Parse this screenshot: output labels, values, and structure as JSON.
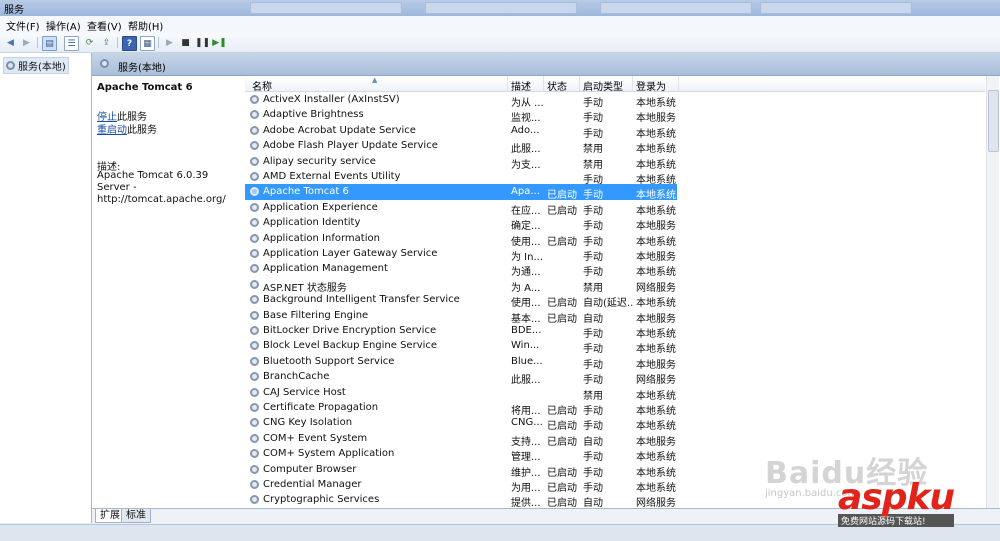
{
  "window": {
    "title": "服务"
  },
  "menu": [
    "文件(F)",
    "操作(A)",
    "查看(V)",
    "帮助(H)"
  ],
  "toolbar": {
    "icons": [
      "back-arrow-icon",
      "forward-arrow-icon",
      "console-tree-icon",
      "list-icon",
      "refresh-icon",
      "export-icon",
      "help-icon",
      "properties-icon",
      "play-icon",
      "stop-icon",
      "pause-icon",
      "restart-icon"
    ]
  },
  "tree": {
    "root_label": "服务(本地)"
  },
  "header": {
    "title": "服务(本地)"
  },
  "detail": {
    "service_name": "Apache Tomcat 6",
    "stop_link": "停止",
    "stop_suffix": "此服务",
    "restart_link": "重启动",
    "restart_suffix": "此服务",
    "desc_label": "描述:",
    "desc_text": "Apache Tomcat 6.0.39 Server - http://tomcat.apache.org/"
  },
  "columns": {
    "name": "名称",
    "desc": "描述",
    "status": "状态",
    "start": "启动类型",
    "logon": "登录为"
  },
  "rows": [
    {
      "name": "ActiveX Installer (AxInstSV)",
      "desc": "为从 ...",
      "status": "",
      "start": "手动",
      "logon": "本地系统"
    },
    {
      "name": "Adaptive Brightness",
      "desc": "监视...",
      "status": "",
      "start": "手动",
      "logon": "本地服务"
    },
    {
      "name": "Adobe Acrobat Update Service",
      "desc": "Ado...",
      "status": "",
      "start": "手动",
      "logon": "本地系统"
    },
    {
      "name": "Adobe Flash Player Update Service",
      "desc": "此服...",
      "status": "",
      "start": "禁用",
      "logon": "本地系统"
    },
    {
      "name": "Alipay security service",
      "desc": "为支...",
      "status": "",
      "start": "禁用",
      "logon": "本地系统"
    },
    {
      "name": "AMD External Events Utility",
      "desc": "",
      "status": "",
      "start": "手动",
      "logon": "本地系统"
    },
    {
      "name": "Apache Tomcat 6",
      "desc": "Apa...",
      "status": "已启动",
      "start": "手动",
      "logon": "本地系统",
      "selected": true
    },
    {
      "name": "Application Experience",
      "desc": "在应...",
      "status": "已启动",
      "start": "手动",
      "logon": "本地系统"
    },
    {
      "name": "Application Identity",
      "desc": "确定...",
      "status": "",
      "start": "手动",
      "logon": "本地服务"
    },
    {
      "name": "Application Information",
      "desc": "使用...",
      "status": "已启动",
      "start": "手动",
      "logon": "本地系统"
    },
    {
      "name": "Application Layer Gateway Service",
      "desc": "为 In...",
      "status": "",
      "start": "手动",
      "logon": "本地服务"
    },
    {
      "name": "Application Management",
      "desc": "为通...",
      "status": "",
      "start": "手动",
      "logon": "本地系统"
    },
    {
      "name": "ASP.NET 状态服务",
      "desc": "为 A...",
      "status": "",
      "start": "禁用",
      "logon": "网络服务"
    },
    {
      "name": "Background Intelligent Transfer Service",
      "desc": "使用...",
      "status": "已启动",
      "start": "自动(延迟...",
      "logon": "本地系统"
    },
    {
      "name": "Base Filtering Engine",
      "desc": "基本...",
      "status": "已启动",
      "start": "自动",
      "logon": "本地服务"
    },
    {
      "name": "BitLocker Drive Encryption Service",
      "desc": "BDE...",
      "status": "",
      "start": "手动",
      "logon": "本地系统"
    },
    {
      "name": "Block Level Backup Engine Service",
      "desc": "Win...",
      "status": "",
      "start": "手动",
      "logon": "本地系统"
    },
    {
      "name": "Bluetooth Support Service",
      "desc": "Blue...",
      "status": "",
      "start": "手动",
      "logon": "本地服务"
    },
    {
      "name": "BranchCache",
      "desc": "此服...",
      "status": "",
      "start": "手动",
      "logon": "网络服务"
    },
    {
      "name": "CAJ Service Host",
      "desc": "",
      "status": "",
      "start": "禁用",
      "logon": "本地系统"
    },
    {
      "name": "Certificate Propagation",
      "desc": "将用...",
      "status": "已启动",
      "start": "手动",
      "logon": "本地系统"
    },
    {
      "name": "CNG Key Isolation",
      "desc": "CNG...",
      "status": "已启动",
      "start": "手动",
      "logon": "本地系统"
    },
    {
      "name": "COM+ Event System",
      "desc": "支持...",
      "status": "已启动",
      "start": "自动",
      "logon": "本地服务"
    },
    {
      "name": "COM+ System Application",
      "desc": "管理...",
      "status": "",
      "start": "手动",
      "logon": "本地系统"
    },
    {
      "name": "Computer Browser",
      "desc": "维护...",
      "status": "已启动",
      "start": "手动",
      "logon": "本地系统"
    },
    {
      "name": "Credential Manager",
      "desc": "为用...",
      "status": "已启动",
      "start": "手动",
      "logon": "本地系统"
    },
    {
      "name": "Cryptographic Services",
      "desc": "提供...",
      "status": "已启动",
      "start": "自动",
      "logon": "网络服务"
    }
  ],
  "tabs": [
    "扩展",
    "标准"
  ],
  "watermark": {
    "baidu": "Baidu经验",
    "baidu_sub": "jingyan.baidu.com",
    "aspku": "aspku",
    "aspku_sub": "免费网站源码下载站!"
  }
}
